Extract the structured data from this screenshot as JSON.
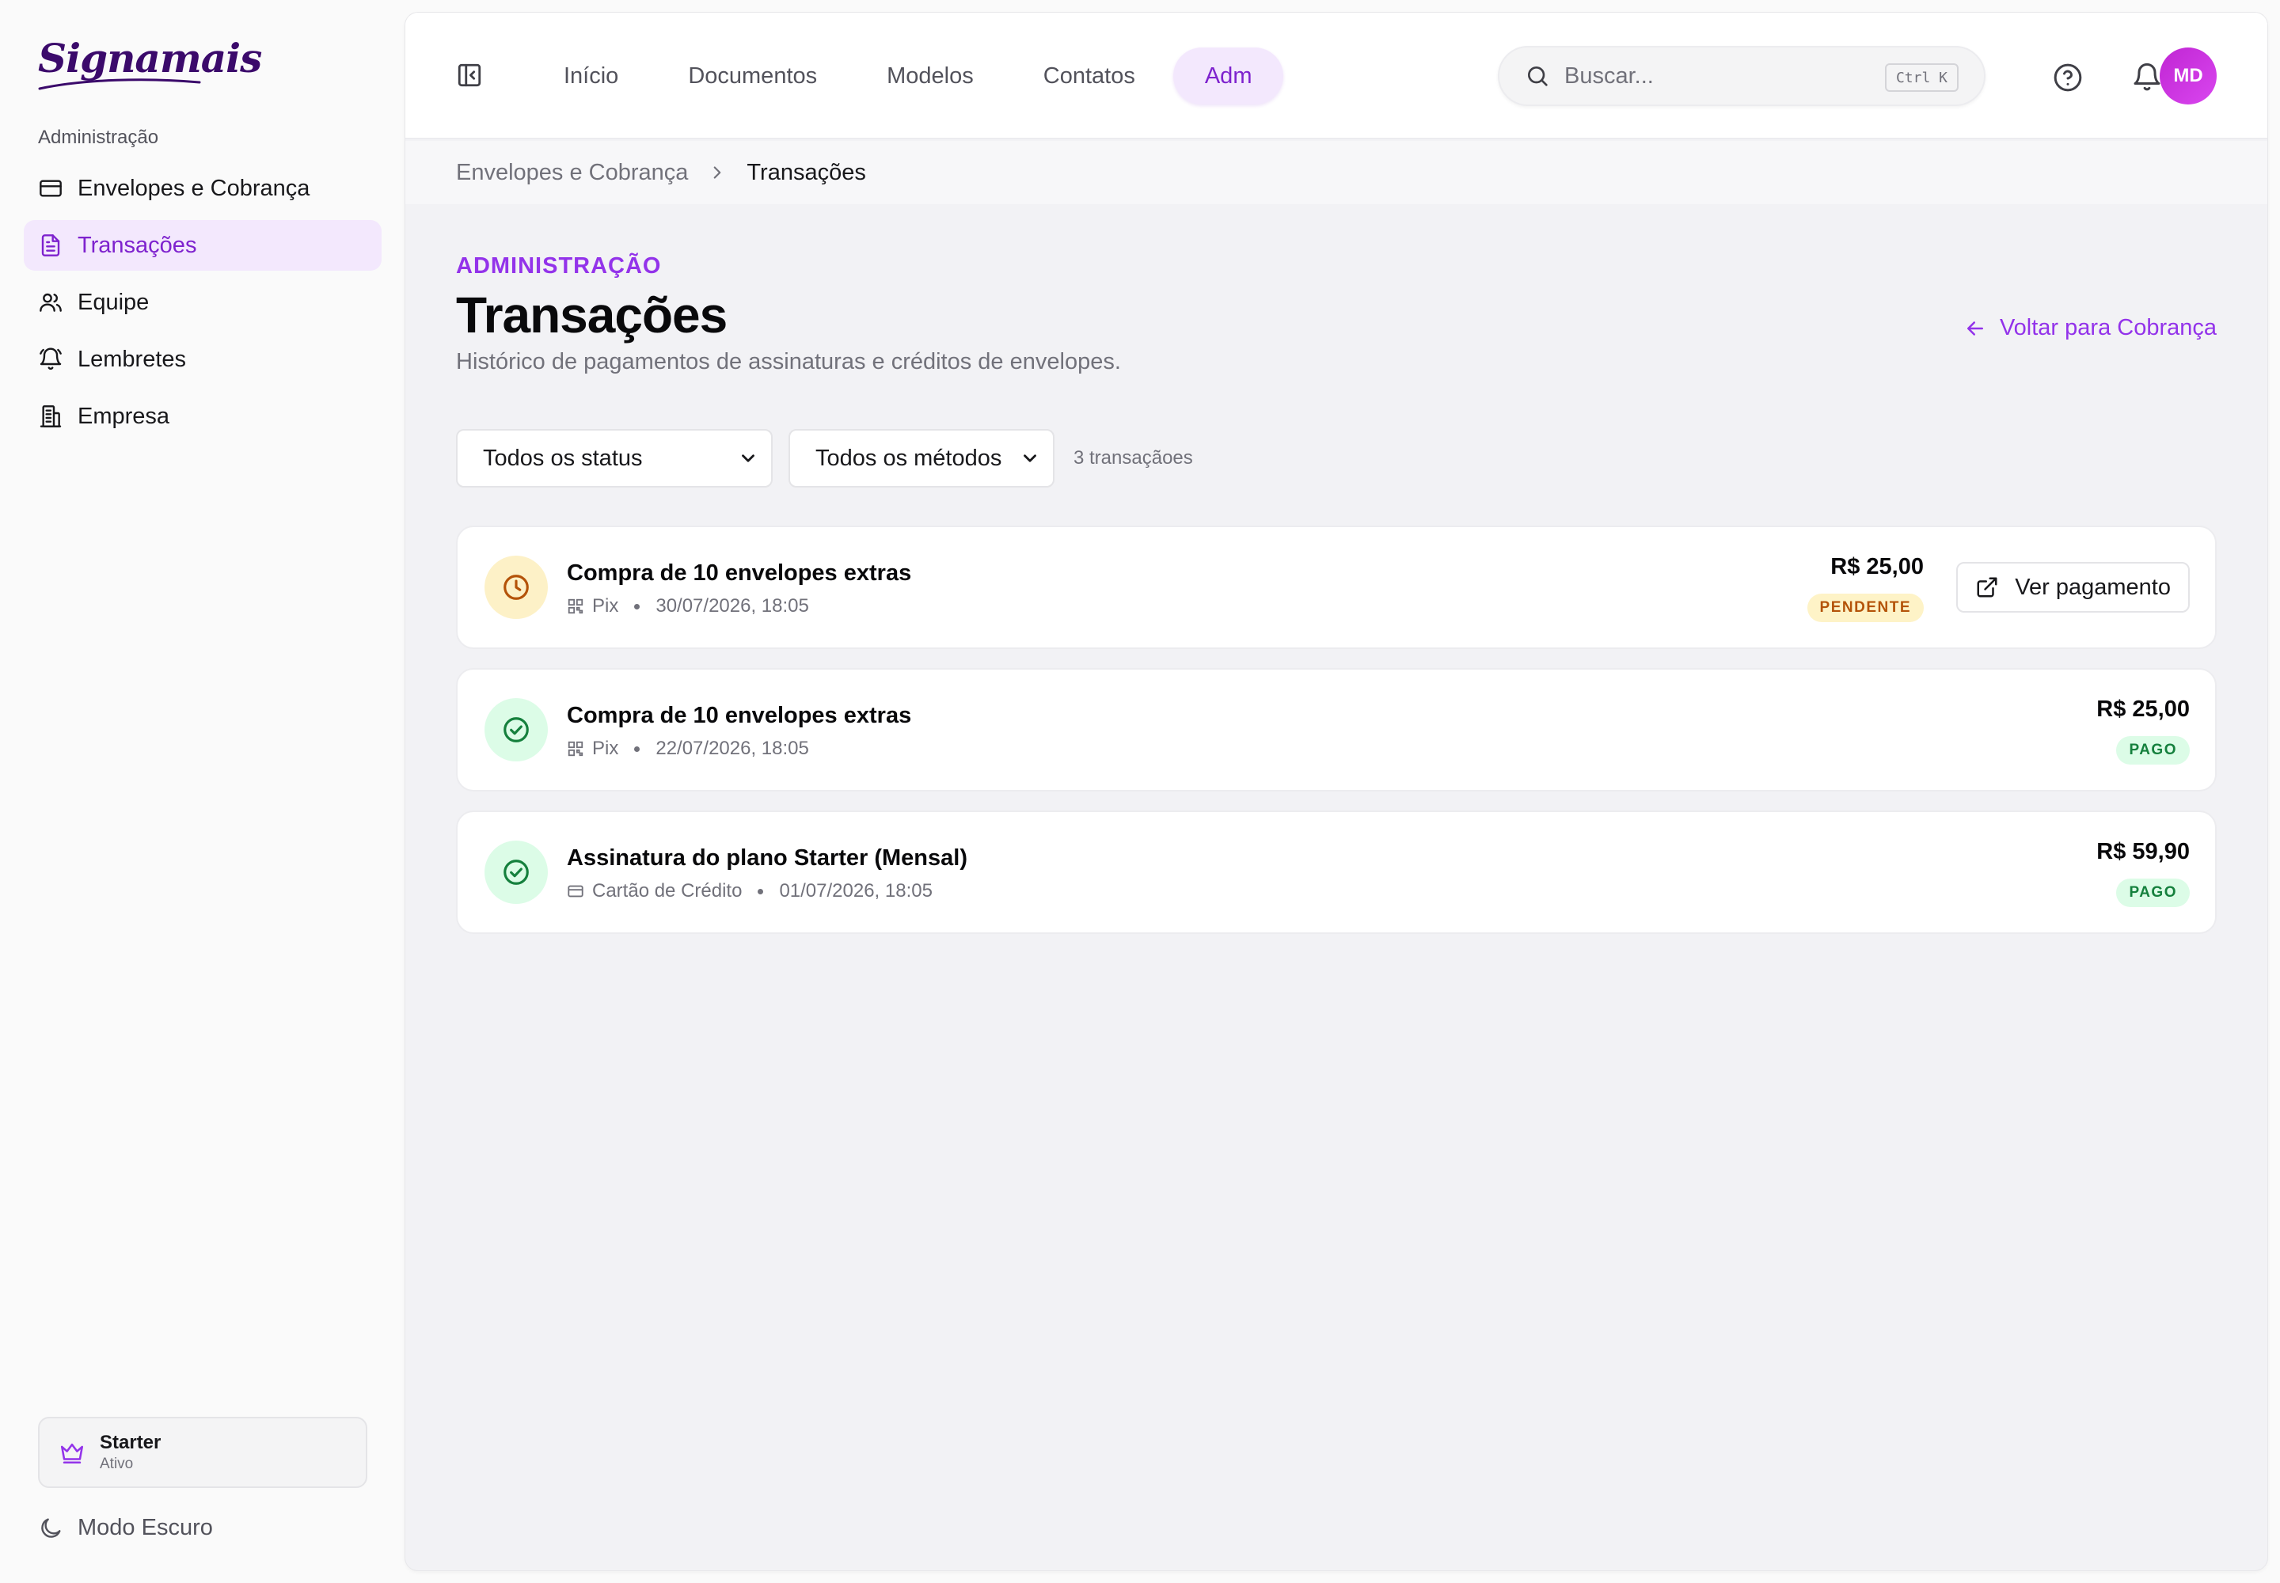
{
  "brand": {
    "logo_text": "Signamais"
  },
  "sidebar": {
    "section_label": "Administração",
    "items": [
      {
        "label": "Envelopes e Cobrança",
        "icon": "credit-card-icon",
        "active": false
      },
      {
        "label": "Transações",
        "icon": "file-text-icon",
        "active": true
      },
      {
        "label": "Equipe",
        "icon": "users-icon",
        "active": false
      },
      {
        "label": "Lembretes",
        "icon": "bell-ring-icon",
        "active": false
      },
      {
        "label": "Empresa",
        "icon": "building-icon",
        "active": false
      }
    ],
    "plan": {
      "name": "Starter",
      "status": "Ativo",
      "icon": "crown-icon"
    },
    "dark_mode_label": "Modo Escuro"
  },
  "topbar": {
    "tabs": [
      {
        "label": "Início",
        "active": false
      },
      {
        "label": "Documentos",
        "active": false
      },
      {
        "label": "Modelos",
        "active": false
      },
      {
        "label": "Contatos",
        "active": false
      },
      {
        "label": "Adm",
        "active": true
      }
    ],
    "search": {
      "placeholder": "Buscar...",
      "shortcut": "Ctrl K"
    },
    "avatar_initials": "MD"
  },
  "breadcrumb": {
    "parent": "Envelopes e Cobrança",
    "current": "Transações"
  },
  "page": {
    "eyebrow": "ADMINISTRAÇÃO",
    "title": "Transações",
    "subtitle": "Histórico de pagamentos de assinaturas e créditos de envelopes.",
    "back_link": "Voltar para Cobrança"
  },
  "filters": {
    "status_selected": "Todos os status",
    "method_selected": "Todos os métodos",
    "count_text": "3 transaçãoes"
  },
  "transactions": [
    {
      "title": "Compra de 10 envelopes extras",
      "method": "Pix",
      "method_icon": "qr-code-icon",
      "datetime": "30/07/2026, 18:05",
      "amount": "R$ 25,00",
      "status": "PENDENTE",
      "status_icon": "clock-icon",
      "action_label": "Ver pagamento"
    },
    {
      "title": "Compra de 10 envelopes extras",
      "method": "Pix",
      "method_icon": "qr-code-icon",
      "datetime": "22/07/2026, 18:05",
      "amount": "R$ 25,00",
      "status": "PAGO",
      "status_icon": "check-circle-icon"
    },
    {
      "title": "Assinatura do plano Starter (Mensal)",
      "method": "Cartão de Crédito",
      "method_icon": "credit-card-icon",
      "datetime": "01/07/2026, 18:05",
      "amount": "R$ 59,90",
      "status": "PAGO",
      "status_icon": "check-circle-icon"
    }
  ],
  "colors": {
    "accent": "#9333ea",
    "accent_bg": "#f3e8fd",
    "pending": "#b45309",
    "paid": "#15803d"
  }
}
